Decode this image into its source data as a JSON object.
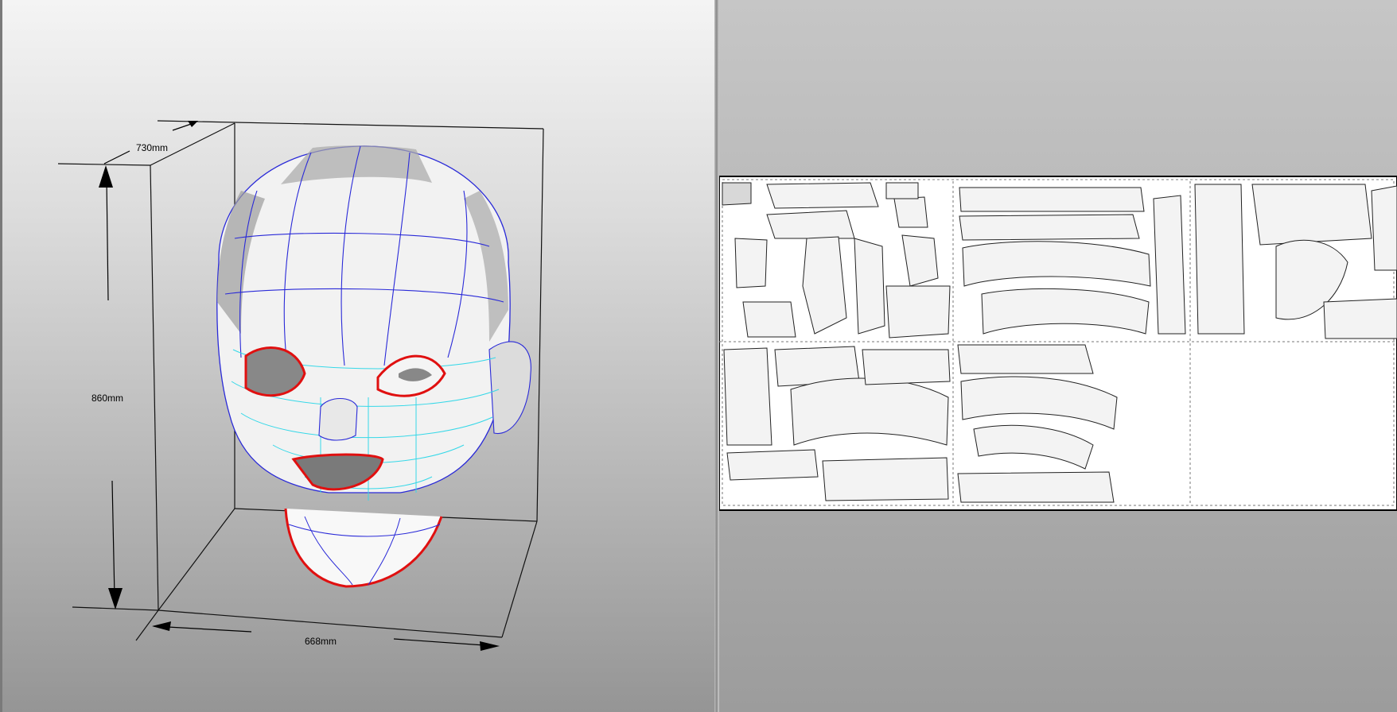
{
  "viewer_3d": {
    "dimensions": {
      "depth": "730mm",
      "height": "860mm",
      "width": "668mm"
    },
    "model": "head mask wireframe"
  },
  "viewer_2d": {
    "sheet_count": 6,
    "sheets_filled": 5
  },
  "colors": {
    "edge_blue": "#2a2ad8",
    "edge_cyan": "#35d8e8",
    "edge_red": "#e01010",
    "sheet_border": "#000000"
  }
}
